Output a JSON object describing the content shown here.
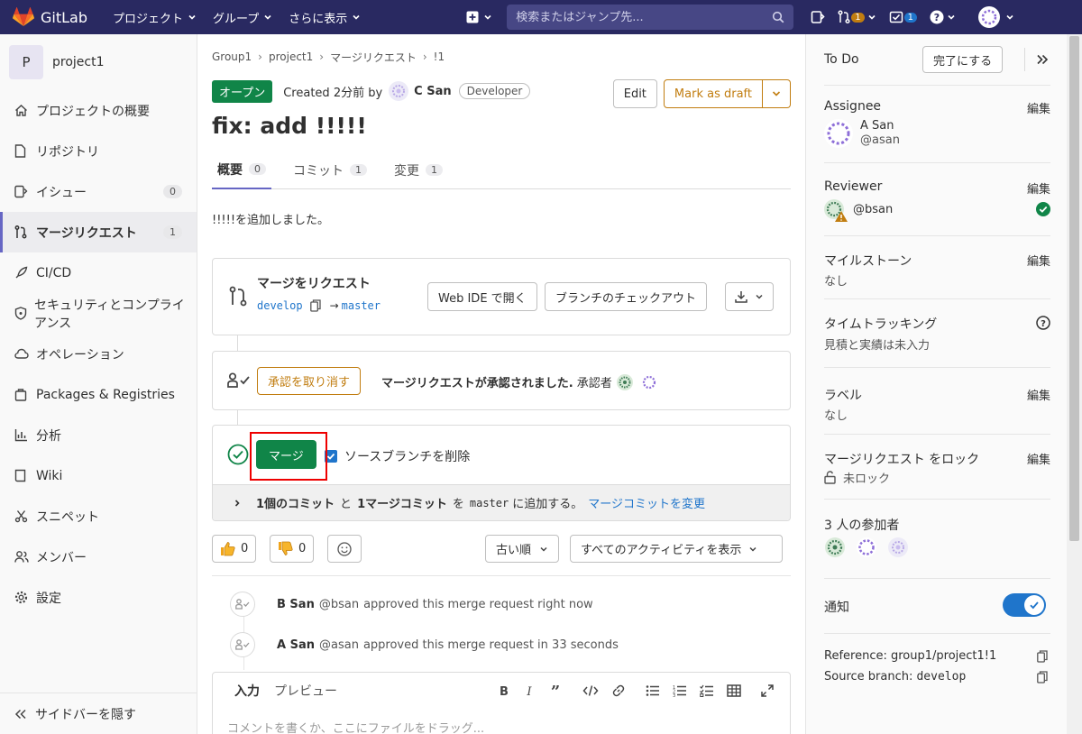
{
  "topbar": {
    "app_name": "GitLab",
    "menus": [
      "プロジェクト",
      "グループ",
      "さらに表示"
    ],
    "search_placeholder": "検索またはジャンプ先...",
    "mr_badge": "1",
    "todo_badge": "1",
    "brand_color": "#292961"
  },
  "sidebar": {
    "project_initial": "P",
    "project_name": "project1",
    "items": [
      {
        "label": "プロジェクトの概要",
        "icon": "home-icon"
      },
      {
        "label": "リポジトリ",
        "icon": "file-icon"
      },
      {
        "label": "イシュー",
        "icon": "issues-icon",
        "count": "0"
      },
      {
        "label": "マージリクエスト",
        "icon": "merge-request-icon",
        "count": "1",
        "active": true
      },
      {
        "label": "CI/CD",
        "icon": "rocket-icon"
      },
      {
        "label": "セキュリティとコンプライアンス",
        "icon": "shield-icon"
      },
      {
        "label": "オペレーション",
        "icon": "cloud-gear-icon"
      },
      {
        "label": "Packages & Registries",
        "icon": "package-icon"
      },
      {
        "label": "分析",
        "icon": "chart-icon"
      },
      {
        "label": "Wiki",
        "icon": "book-icon"
      },
      {
        "label": "スニペット",
        "icon": "snippet-icon"
      },
      {
        "label": "メンバー",
        "icon": "users-icon"
      },
      {
        "label": "設定",
        "icon": "settings-icon"
      }
    ],
    "collapse_label": "サイドバーを隠す"
  },
  "breadcrumb": [
    "Group1",
    "project1",
    "マージリクエスト",
    "!1"
  ],
  "mr": {
    "status": "オープン",
    "created": "Created 2分前 by",
    "author": "C San",
    "role": "Developer",
    "edit_label": "Edit",
    "draft_label": "Mark as draft",
    "title": "fix: add !!!!!",
    "tabs": [
      {
        "label": "概要",
        "count": "0"
      },
      {
        "label": "コミット",
        "count": "1"
      },
      {
        "label": "変更",
        "count": "1"
      }
    ],
    "description": "!!!!!を追加しました。"
  },
  "widget": {
    "heading": "マージをリクエスト",
    "source_branch": "develop",
    "arrow": "→",
    "target_branch": "master",
    "webide_label": "Web IDE で開く",
    "checkout_label": "ブランチのチェックアウト",
    "revoke_label": "承認を取り消す",
    "approved_text": "マージリクエストが承認されました.",
    "approvers_label": "承認者",
    "merge_label": "マージ",
    "delete_source_label": "ソースブランチを削除",
    "commits_bold": "1個のコミット",
    "and": "と",
    "merge_commit_bold": "1マージコミット",
    "to": "を",
    "target_mono": "master",
    "add_text": "に追加する。",
    "modify_link": "マージコミットを変更"
  },
  "reactions": {
    "thumbs_up": "0",
    "thumbs_down": "0",
    "sort_label": "古い順",
    "filter_label": "すべてのアクティビティを表示"
  },
  "activity": [
    {
      "name": "B San",
      "handle": "@bsan",
      "text": "approved this merge request right now"
    },
    {
      "name": "A San",
      "handle": "@asan",
      "text": "approved this merge request in 33 seconds"
    }
  ],
  "editor": {
    "tab_write": "入力",
    "tab_preview": "プレビュー",
    "placeholder": "コメントを書くか、ここにファイルをドラッグ..."
  },
  "right": {
    "todo_label": "To Do",
    "done_button": "完了にする",
    "assignee_label": "Assignee",
    "edit": "編集",
    "assignee_name": "A San",
    "assignee_handle": "@asan",
    "reviewer_label": "Reviewer",
    "reviewer_handle": "@bsan",
    "milestone_label": "マイルストーン",
    "milestone_value": "なし",
    "time_label": "タイムトラッキング",
    "time_value": "見積と実績は未入力",
    "labels_label": "ラベル",
    "labels_value": "なし",
    "lock_label": "マージリクエスト をロック",
    "lock_value": "未ロック",
    "participants_label": "3 人の参加者",
    "notify_label": "通知",
    "reference": "Reference: group1/project1!1",
    "source_branch_prefix": "Source branch: ",
    "source_branch": "develop"
  }
}
